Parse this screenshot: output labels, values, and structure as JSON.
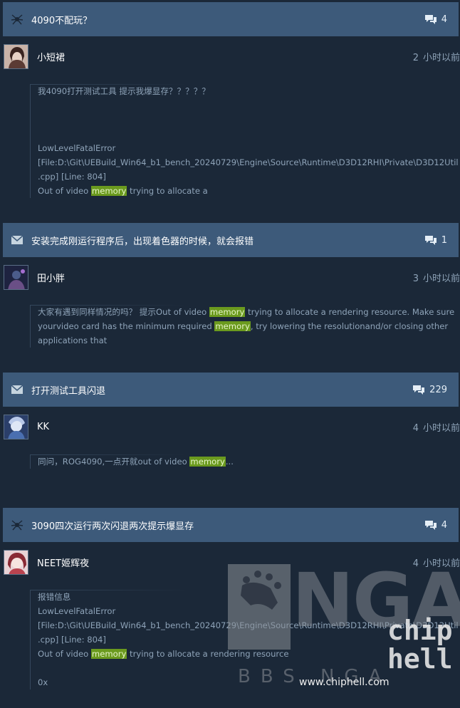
{
  "threads": [
    {
      "title": "4090不配玩？",
      "icon": "spider-icon",
      "replies": "4",
      "author": "小短裙",
      "time_num": "2",
      "time_unit": "小时以前",
      "lines": [
        "我4090打开测试工具 提示我爆显存？？？？？",
        "",
        "",
        "",
        "LowLevelFatalError",
        "[File:D:\\Git\\UEBuild_Win64_b1_bench_20240729\\Engine\\Source\\Runtime\\D3D12RHI\\Private\\D3D12Util",
        ".cpp] [Line: 804]",
        "Out of video |memory| trying to allocate a"
      ]
    },
    {
      "title": "安装完成刚运行程序后，出现着色器的时候，就会报错",
      "icon": "envelope-icon",
      "replies": "1",
      "author": "田小胖",
      "time_num": "3",
      "time_unit": "小时以前",
      "lines": [
        "大家有遇到同样情况的吗？ 提示Out of video |memory| trying to allocate a rendering resource. Make sure",
        "yourvideo card has the minimum required |memory|, try lowering the resolutionand/or closing other",
        "applications that"
      ]
    },
    {
      "title": "打开测试工具闪退",
      "icon": "envelope-icon",
      "replies": "229",
      "author": "KK",
      "time_num": "4",
      "time_unit": "小时以前",
      "lines": [
        "同问，ROG4090,一点开就out of video |memory|..."
      ]
    },
    {
      "title": "3090四次运行两次闪退两次提示爆显存",
      "icon": "spider-icon",
      "replies": "4",
      "author": "NEET姬辉夜",
      "time_num": "4",
      "time_unit": "小时以前",
      "lines": [
        "报错信息",
        "LowLevelFatalError",
        "[File:D:\\Git\\UEBuild_Win64_b1_bench_20240729\\Engine\\Source\\Runtime\\D3D12RHI\\Private\\D3D12Util",
        ".cpp] [Line: 804]",
        "Out of video |memory| trying to allocate a rendering resource",
        "",
        "0x"
      ]
    }
  ],
  "watermarks": {
    "nga_text": "NGA",
    "nga_sub": "BBS NGA",
    "chiphell_logo": "chip hell",
    "chiphell_url": "www.chiphell.com"
  },
  "colors": {
    "background": "#1b2838",
    "header": "#3d5a7a",
    "highlight": "#6b9a1e"
  }
}
